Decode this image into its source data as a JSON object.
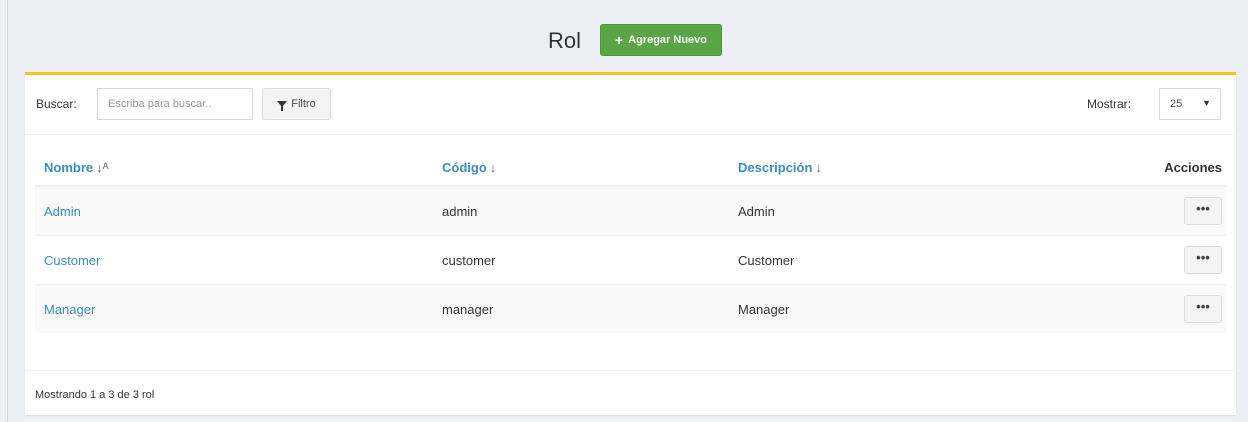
{
  "header": {
    "title": "Rol",
    "add_button": {
      "icon": "plus-icon",
      "label": "Agregar Nuevo",
      "color": "#5aa545"
    }
  },
  "panel": {
    "accent_color": "#f7c31d"
  },
  "toolbar": {
    "search_label": "Buscar:",
    "search_placeholder": "Escriba para buscar..",
    "search_value": "",
    "filter_button": {
      "icon": "filter-icon",
      "label": "Filtro"
    },
    "show_label": "Mostrar:",
    "show_value": "25"
  },
  "table": {
    "columns": [
      {
        "label": "Nombre",
        "sort_icon": "sort-alpha-down-icon",
        "sort_glyph": "↓ᴬ"
      },
      {
        "label": "Código",
        "sort_icon": "sort-down-icon",
        "sort_glyph": "↓"
      },
      {
        "label": "Descripción",
        "sort_icon": "sort-down-icon",
        "sort_glyph": "↓"
      },
      {
        "label": "Acciones"
      }
    ],
    "rows": [
      {
        "name": "Admin",
        "code": "admin",
        "description": "Admin",
        "action": "•••"
      },
      {
        "name": "Customer",
        "code": "customer",
        "description": "Customer",
        "action": "•••"
      },
      {
        "name": "Manager",
        "code": "manager",
        "description": "Manager",
        "action": "•••"
      }
    ]
  },
  "footer": {
    "text": "Mostrando 1 a 3 de 3 rol"
  }
}
